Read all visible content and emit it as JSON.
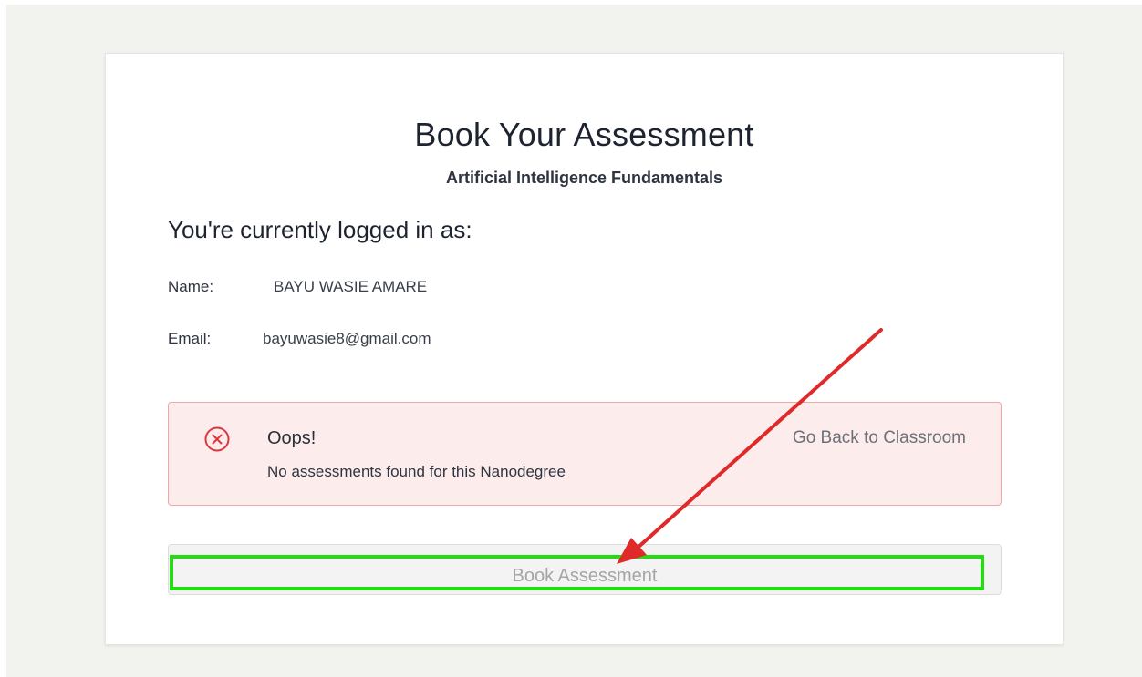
{
  "header": {
    "title": "Book Your Assessment",
    "subtitle": "Artificial Intelligence Fundamentals"
  },
  "account": {
    "heading": "You're currently logged in as:",
    "name_label": "Name:",
    "name_value": "BAYU WASIE AMARE",
    "email_label": "Email:",
    "email_value": "bayuwasie8@gmail.com"
  },
  "alert": {
    "icon": "error-circle-x-icon",
    "title": "Oops!",
    "message": "No assessments found for this Nanodegree",
    "link_label": "Go Back to Classroom",
    "color": "#e0353b",
    "background": "#fdecec"
  },
  "actions": {
    "book_label": "Book Assessment",
    "book_disabled": true
  },
  "annotations": {
    "highlight_color": "#22dd10",
    "arrow_color": "#e02a2a"
  }
}
